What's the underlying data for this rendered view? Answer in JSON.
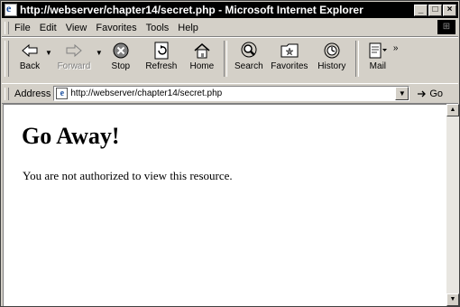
{
  "window": {
    "title": "http://webserver/chapter14/secret.php - Microsoft Internet Explorer",
    "minimize": "_",
    "maximize": "□",
    "close": "×"
  },
  "menu": {
    "items": [
      "File",
      "Edit",
      "View",
      "Favorites",
      "Tools",
      "Help"
    ]
  },
  "toolbar": {
    "back": "Back",
    "forward": "Forward",
    "stop": "Stop",
    "refresh": "Refresh",
    "home": "Home",
    "search": "Search",
    "favorites": "Favorites",
    "history": "History",
    "mail": "Mail"
  },
  "address": {
    "label": "Address",
    "url": "http://webserver/chapter14/secret.php",
    "go": "Go"
  },
  "page": {
    "heading": "Go Away!",
    "text": "You are not authorized to view this resource."
  }
}
